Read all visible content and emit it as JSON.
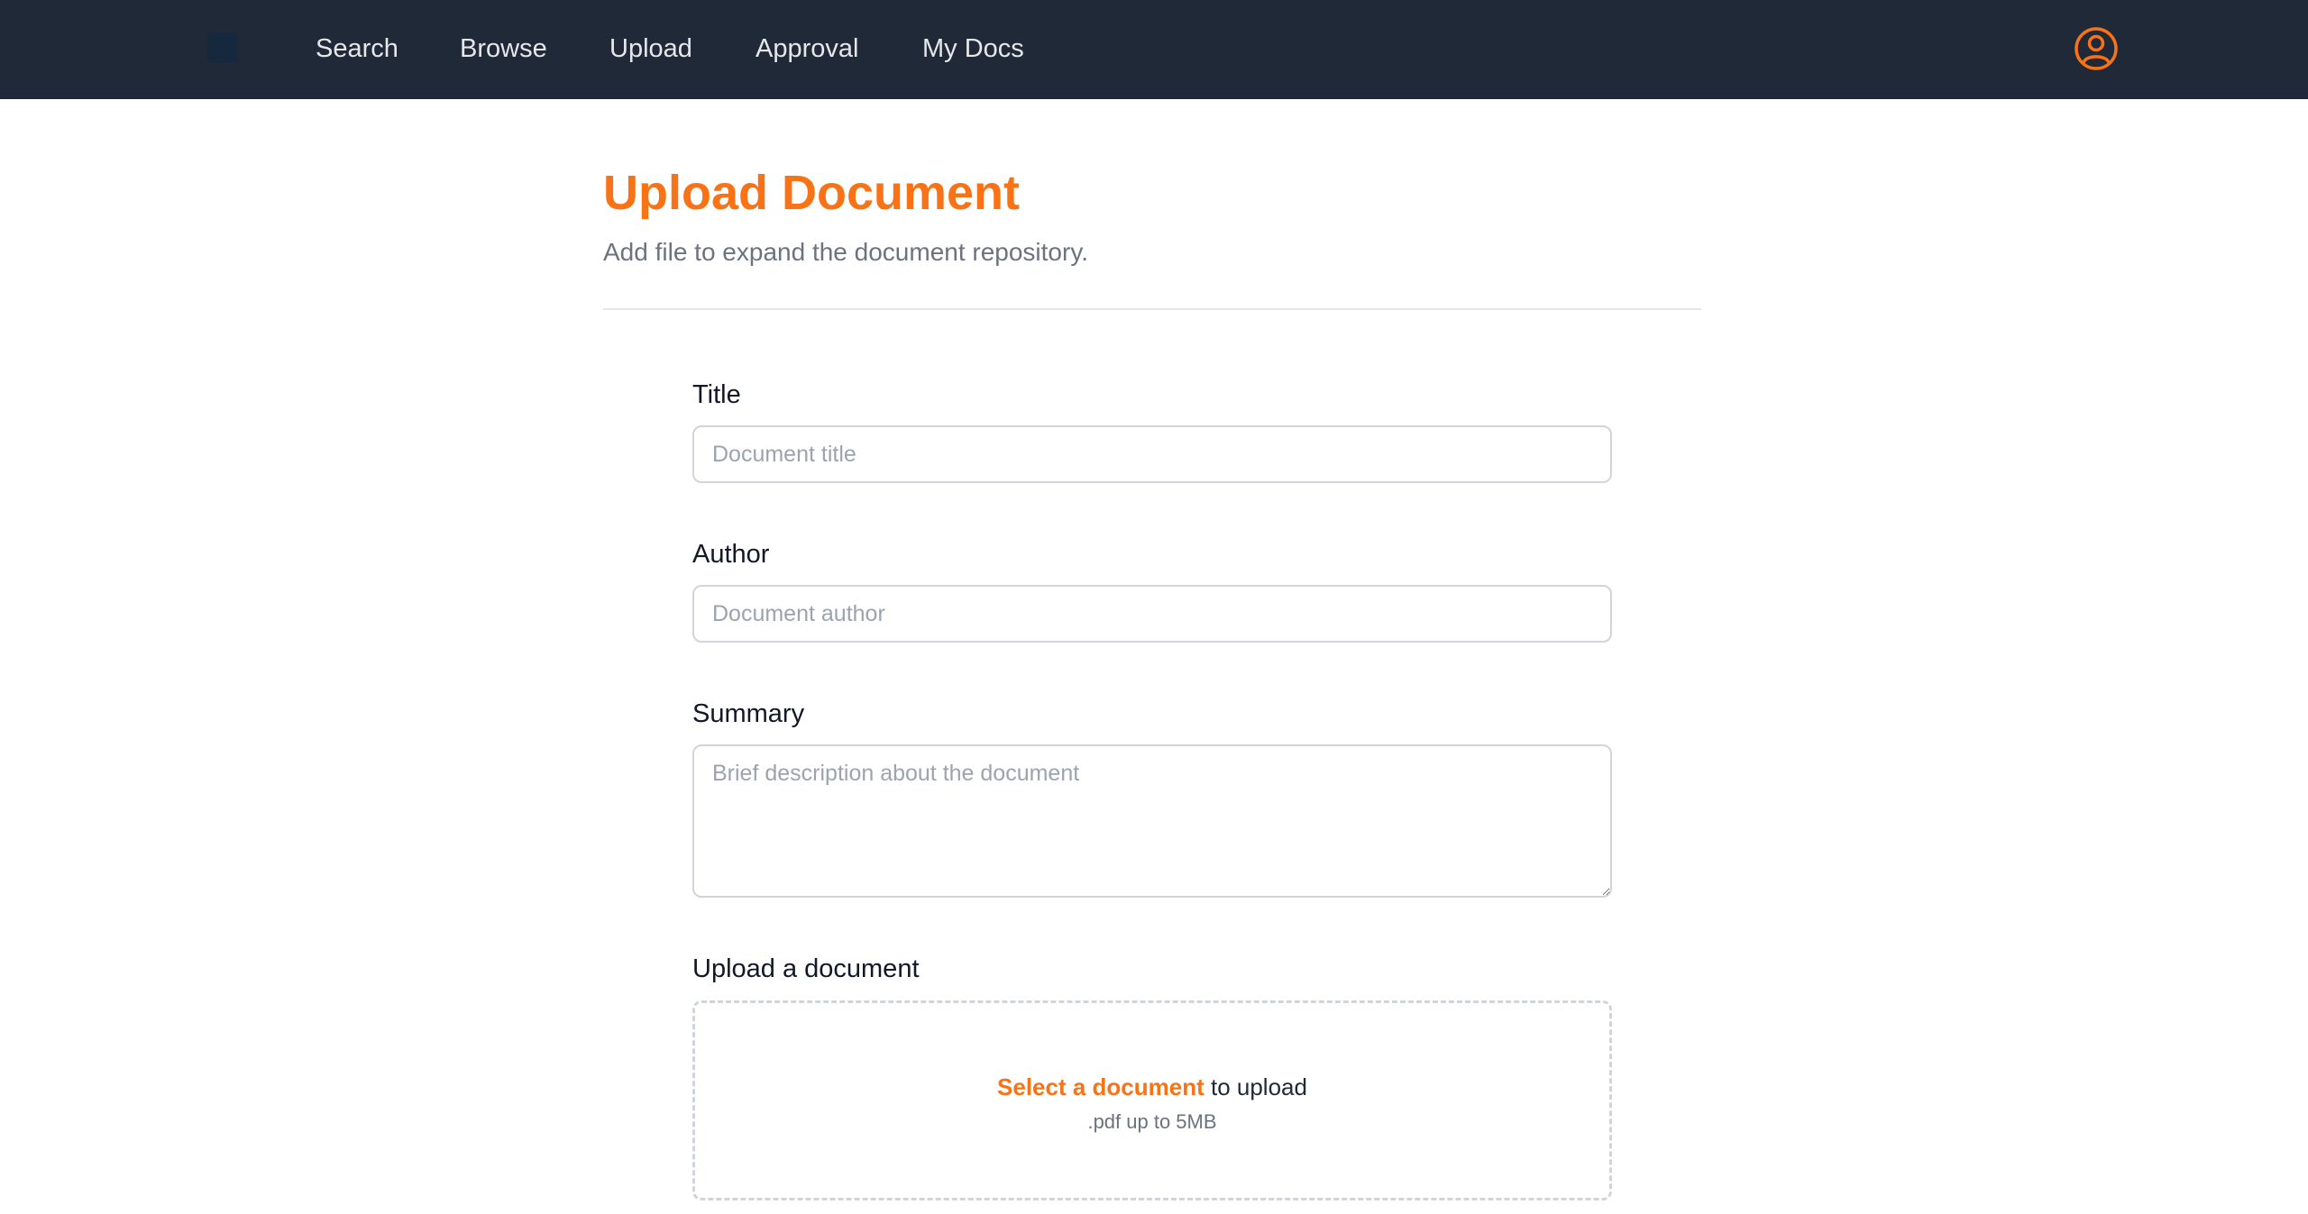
{
  "nav": {
    "items": [
      {
        "label": "Search"
      },
      {
        "label": "Browse"
      },
      {
        "label": "Upload"
      },
      {
        "label": "Approval"
      },
      {
        "label": "My Docs"
      }
    ],
    "profile_icon": "user-circle-icon"
  },
  "header": {
    "title": "Upload Document",
    "subtitle": "Add file to expand the document repository."
  },
  "form": {
    "title": {
      "label": "Title",
      "value": "",
      "placeholder": "Document title"
    },
    "author": {
      "label": "Author",
      "value": "",
      "placeholder": "Document author"
    },
    "summary": {
      "label": "Summary",
      "value": "",
      "placeholder": "Brief description about the document"
    },
    "upload": {
      "label": "Upload a document",
      "select_link": "Select a document",
      "select_suffix": " to upload",
      "hint": ".pdf up to 5MB"
    }
  },
  "colors": {
    "accent": "#f97316",
    "navbar": "#1f2937",
    "nav_text": "#e5e7eb",
    "muted_text": "#6b7280",
    "border": "#d1d5db"
  }
}
